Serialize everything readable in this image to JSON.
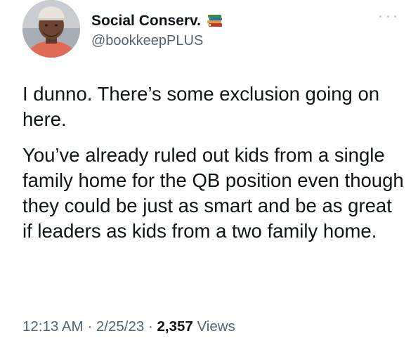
{
  "author": {
    "display_name": "Social Conserv.",
    "handle": "@bookkeepPLUS",
    "badge_icon": "books-icon",
    "avatar_icon": "avatar-photo"
  },
  "more_icon": "more-options-icon",
  "body": {
    "paragraphs": [
      "I dunno. There’s some exclusion going on here.",
      "You’ve already ruled out kids from a single family home for the QB position even though they could be just as smart and be as great if leaders as kids from a two family home."
    ]
  },
  "meta": {
    "time": "12:13 AM",
    "separator": " · ",
    "date": "2/25/23",
    "views_count": "2,357",
    "views_label": " Views"
  },
  "colors": {
    "text": "#0f1419",
    "secondary": "#536471",
    "background": "#ffffff"
  }
}
